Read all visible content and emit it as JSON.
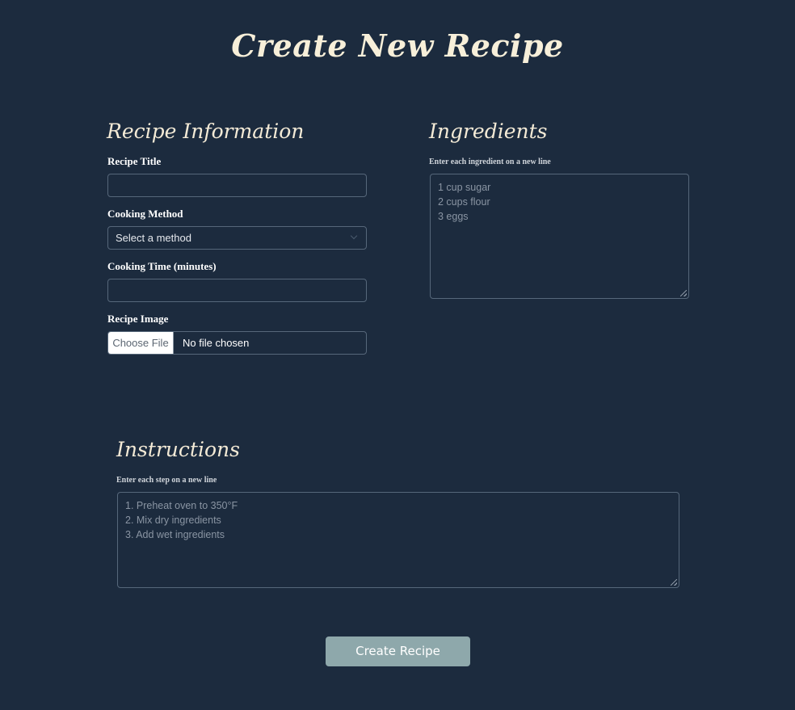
{
  "page": {
    "title": "Create New Recipe"
  },
  "recipe_info": {
    "heading": "Recipe Information",
    "title_label": "Recipe Title",
    "title_value": "",
    "method_label": "Cooking Method",
    "method_selected": "Select a method",
    "time_label": "Cooking Time (minutes)",
    "time_value": "",
    "image_label": "Recipe Image",
    "image_button": "Choose File",
    "image_status": "No file chosen"
  },
  "ingredients": {
    "heading": "Ingredients",
    "hint": "Enter each ingredient on a new line",
    "placeholder_lines": [
      "1 cup sugar",
      "2 cups flour",
      "3 eggs"
    ]
  },
  "instructions": {
    "heading": "Instructions",
    "hint": "Enter each step on a new line",
    "placeholder_lines": [
      "1. Preheat oven to 350°F",
      "2. Mix dry ingredients",
      "3. Add wet ingredients"
    ]
  },
  "actions": {
    "submit_label": "Create Recipe"
  },
  "colors": {
    "background": "#1c2b3e",
    "heading_text": "#f3ead6",
    "input_border": "#56677a",
    "submit_button": "#8ea8ab"
  },
  "icons": {
    "method_dropdown": "chevron-down-icon",
    "textarea_resize": "resize-grip-icon"
  }
}
